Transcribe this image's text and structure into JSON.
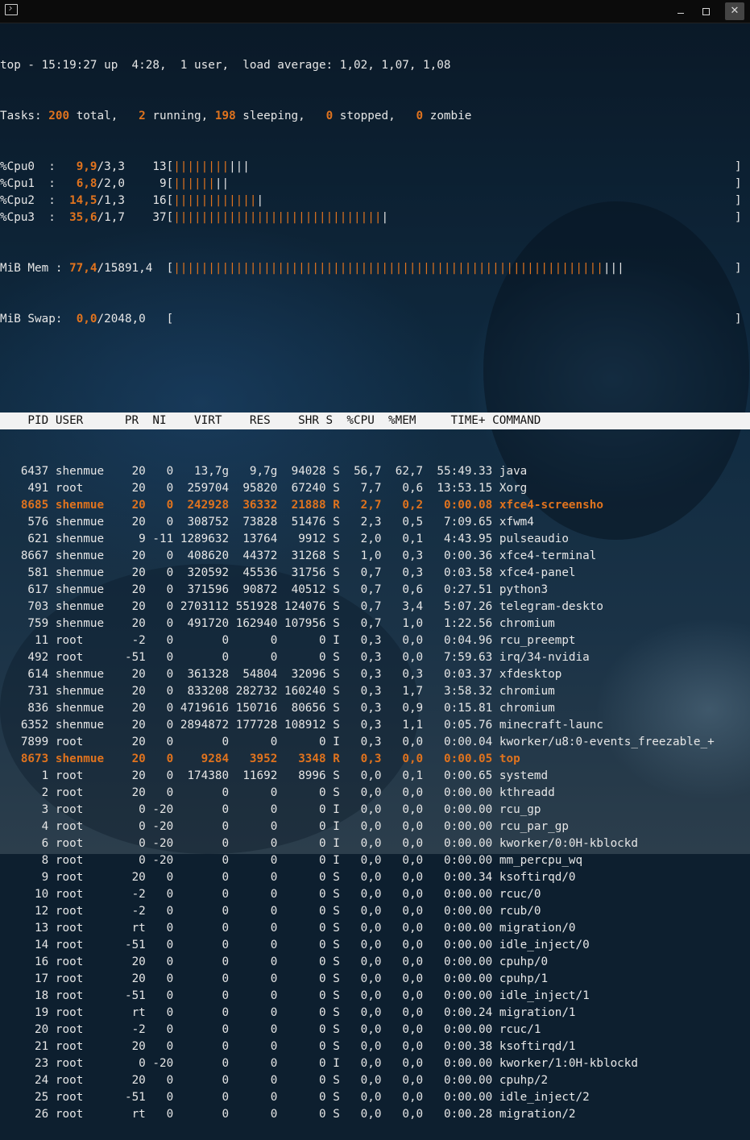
{
  "window": {
    "icon": "terminal-icon",
    "buttons": [
      "minimize-icon",
      "maximize-icon",
      "close-icon"
    ],
    "close_label": "✕"
  },
  "colors": {
    "accent": "#e0731e",
    "text": "#e6e6e6",
    "header_bg": "#f2f2f2"
  },
  "summary": {
    "top": "top - 15:19:27 up  4:28,  1 user,  load average: 1,02, 1,07, 1,08",
    "tasks": {
      "label": "Tasks: ",
      "total": "200",
      "total_l": " total,   ",
      "running": "2",
      "running_l": " running, ",
      "sleeping": "198",
      "sleeping_l": " sleeping,   ",
      "stopped": "0",
      "stopped_l": " stopped,   ",
      "zombie": "0",
      "zombie_l": " zombie"
    },
    "cpus": [
      {
        "label": "%Cpu0  :   ",
        "us": "9,9",
        "rest": "/3,3    13[",
        "bar_orange": "||||||||",
        "bar_white": "|||"
      },
      {
        "label": "%Cpu1  :   ",
        "us": "6,8",
        "rest": "/2,0     9[",
        "bar_orange": "||||||",
        "bar_white": "||"
      },
      {
        "label": "%Cpu2  :  ",
        "us": "14,5",
        "rest": "/1,3    16[",
        "bar_orange": "||||||||||||",
        "bar_white": "|"
      },
      {
        "label": "%Cpu3  :  ",
        "us": "35,6",
        "rest": "/1,7    37[",
        "bar_orange": "||||||||||||||||||||||||||||||",
        "bar_white": "|"
      }
    ],
    "mem": {
      "label": "MiB Mem : ",
      "used": "77,4",
      "rest": "/15891,4  [",
      "bar_orange": "||||||||||||||||||||||||||||||||||||||||||||||||||||||||||||||",
      "bar_white": "|||"
    },
    "swap": {
      "label": "MiB Swap:  ",
      "used": "0,0",
      "rest": "/2048,0   ["
    },
    "bracket_close": "]"
  },
  "table": {
    "header": "    PID USER      PR  NI    VIRT    RES    SHR S  %CPU  %MEM     TIME+ COMMAND",
    "columns": [
      "PID",
      "USER",
      "PR",
      "NI",
      "VIRT",
      "RES",
      "SHR",
      "S",
      "%CPU",
      "%MEM",
      "TIME+",
      "COMMAND"
    ],
    "rows": [
      [
        "6437",
        "shenmue",
        "20",
        "0",
        "13,7g",
        "9,7g",
        "94028",
        "S",
        "56,7",
        "62,7",
        "55:49.33",
        "java"
      ],
      [
        "491",
        "root",
        "20",
        "0",
        "259704",
        "95820",
        "67240",
        "S",
        "7,7",
        "0,6",
        "13:53.15",
        "Xorg"
      ],
      [
        "8685",
        "shenmue",
        "20",
        "0",
        "242928",
        "36332",
        "21888",
        "R",
        "2,7",
        "0,2",
        "0:00.08",
        "xfce4-screensho"
      ],
      [
        "576",
        "shenmue",
        "20",
        "0",
        "308752",
        "73828",
        "51476",
        "S",
        "2,3",
        "0,5",
        "7:09.65",
        "xfwm4"
      ],
      [
        "621",
        "shenmue",
        "9",
        "-11",
        "1289632",
        "13764",
        "9912",
        "S",
        "2,0",
        "0,1",
        "4:43.95",
        "pulseaudio"
      ],
      [
        "8667",
        "shenmue",
        "20",
        "0",
        "408620",
        "44372",
        "31268",
        "S",
        "1,0",
        "0,3",
        "0:00.36",
        "xfce4-terminal"
      ],
      [
        "581",
        "shenmue",
        "20",
        "0",
        "320592",
        "45536",
        "31756",
        "S",
        "0,7",
        "0,3",
        "0:03.58",
        "xfce4-panel"
      ],
      [
        "617",
        "shenmue",
        "20",
        "0",
        "371596",
        "90872",
        "40512",
        "S",
        "0,7",
        "0,6",
        "0:27.51",
        "python3"
      ],
      [
        "703",
        "shenmue",
        "20",
        "0",
        "2703112",
        "551928",
        "124076",
        "S",
        "0,7",
        "3,4",
        "5:07.26",
        "telegram-deskto"
      ],
      [
        "759",
        "shenmue",
        "20",
        "0",
        "491720",
        "162940",
        "107956",
        "S",
        "0,7",
        "1,0",
        "1:22.56",
        "chromium"
      ],
      [
        "11",
        "root",
        "-2",
        "0",
        "0",
        "0",
        "0",
        "I",
        "0,3",
        "0,0",
        "0:04.96",
        "rcu_preempt"
      ],
      [
        "492",
        "root",
        "-51",
        "0",
        "0",
        "0",
        "0",
        "S",
        "0,3",
        "0,0",
        "7:59.63",
        "irq/34-nvidia"
      ],
      [
        "614",
        "shenmue",
        "20",
        "0",
        "361328",
        "54804",
        "32096",
        "S",
        "0,3",
        "0,3",
        "0:03.37",
        "xfdesktop"
      ],
      [
        "731",
        "shenmue",
        "20",
        "0",
        "833208",
        "282732",
        "160240",
        "S",
        "0,3",
        "1,7",
        "3:58.32",
        "chromium"
      ],
      [
        "836",
        "shenmue",
        "20",
        "0",
        "4719616",
        "150716",
        "80656",
        "S",
        "0,3",
        "0,9",
        "0:15.81",
        "chromium"
      ],
      [
        "6352",
        "shenmue",
        "20",
        "0",
        "2894872",
        "177728",
        "108912",
        "S",
        "0,3",
        "1,1",
        "0:05.76",
        "minecraft-launc"
      ],
      [
        "7899",
        "root",
        "20",
        "0",
        "0",
        "0",
        "0",
        "I",
        "0,3",
        "0,0",
        "0:00.04",
        "kworker/u8:0-events_freezable_+"
      ],
      [
        "8673",
        "shenmue",
        "20",
        "0",
        "9284",
        "3952",
        "3348",
        "R",
        "0,3",
        "0,0",
        "0:00.05",
        "top"
      ],
      [
        "1",
        "root",
        "20",
        "0",
        "174380",
        "11692",
        "8996",
        "S",
        "0,0",
        "0,1",
        "0:00.65",
        "systemd"
      ],
      [
        "2",
        "root",
        "20",
        "0",
        "0",
        "0",
        "0",
        "S",
        "0,0",
        "0,0",
        "0:00.00",
        "kthreadd"
      ],
      [
        "3",
        "root",
        "0",
        "-20",
        "0",
        "0",
        "0",
        "I",
        "0,0",
        "0,0",
        "0:00.00",
        "rcu_gp"
      ],
      [
        "4",
        "root",
        "0",
        "-20",
        "0",
        "0",
        "0",
        "I",
        "0,0",
        "0,0",
        "0:00.00",
        "rcu_par_gp"
      ],
      [
        "6",
        "root",
        "0",
        "-20",
        "0",
        "0",
        "0",
        "I",
        "0,0",
        "0,0",
        "0:00.00",
        "kworker/0:0H-kblockd"
      ],
      [
        "8",
        "root",
        "0",
        "-20",
        "0",
        "0",
        "0",
        "I",
        "0,0",
        "0,0",
        "0:00.00",
        "mm_percpu_wq"
      ],
      [
        "9",
        "root",
        "20",
        "0",
        "0",
        "0",
        "0",
        "S",
        "0,0",
        "0,0",
        "0:00.34",
        "ksoftirqd/0"
      ],
      [
        "10",
        "root",
        "-2",
        "0",
        "0",
        "0",
        "0",
        "S",
        "0,0",
        "0,0",
        "0:00.00",
        "rcuc/0"
      ],
      [
        "12",
        "root",
        "-2",
        "0",
        "0",
        "0",
        "0",
        "S",
        "0,0",
        "0,0",
        "0:00.00",
        "rcub/0"
      ],
      [
        "13",
        "root",
        "rt",
        "0",
        "0",
        "0",
        "0",
        "S",
        "0,0",
        "0,0",
        "0:00.00",
        "migration/0"
      ],
      [
        "14",
        "root",
        "-51",
        "0",
        "0",
        "0",
        "0",
        "S",
        "0,0",
        "0,0",
        "0:00.00",
        "idle_inject/0"
      ],
      [
        "16",
        "root",
        "20",
        "0",
        "0",
        "0",
        "0",
        "S",
        "0,0",
        "0,0",
        "0:00.00",
        "cpuhp/0"
      ],
      [
        "17",
        "root",
        "20",
        "0",
        "0",
        "0",
        "0",
        "S",
        "0,0",
        "0,0",
        "0:00.00",
        "cpuhp/1"
      ],
      [
        "18",
        "root",
        "-51",
        "0",
        "0",
        "0",
        "0",
        "S",
        "0,0",
        "0,0",
        "0:00.00",
        "idle_inject/1"
      ],
      [
        "19",
        "root",
        "rt",
        "0",
        "0",
        "0",
        "0",
        "S",
        "0,0",
        "0,0",
        "0:00.24",
        "migration/1"
      ],
      [
        "20",
        "root",
        "-2",
        "0",
        "0",
        "0",
        "0",
        "S",
        "0,0",
        "0,0",
        "0:00.00",
        "rcuc/1"
      ],
      [
        "21",
        "root",
        "20",
        "0",
        "0",
        "0",
        "0",
        "S",
        "0,0",
        "0,0",
        "0:00.38",
        "ksoftirqd/1"
      ],
      [
        "23",
        "root",
        "0",
        "-20",
        "0",
        "0",
        "0",
        "I",
        "0,0",
        "0,0",
        "0:00.00",
        "kworker/1:0H-kblockd"
      ],
      [
        "24",
        "root",
        "20",
        "0",
        "0",
        "0",
        "0",
        "S",
        "0,0",
        "0,0",
        "0:00.00",
        "cpuhp/2"
      ],
      [
        "25",
        "root",
        "-51",
        "0",
        "0",
        "0",
        "0",
        "S",
        "0,0",
        "0,0",
        "0:00.00",
        "idle_inject/2"
      ],
      [
        "26",
        "root",
        "rt",
        "0",
        "0",
        "0",
        "0",
        "S",
        "0,0",
        "0,0",
        "0:00.28",
        "migration/2"
      ]
    ],
    "highlighted_pids": [
      "8685",
      "8673"
    ]
  }
}
